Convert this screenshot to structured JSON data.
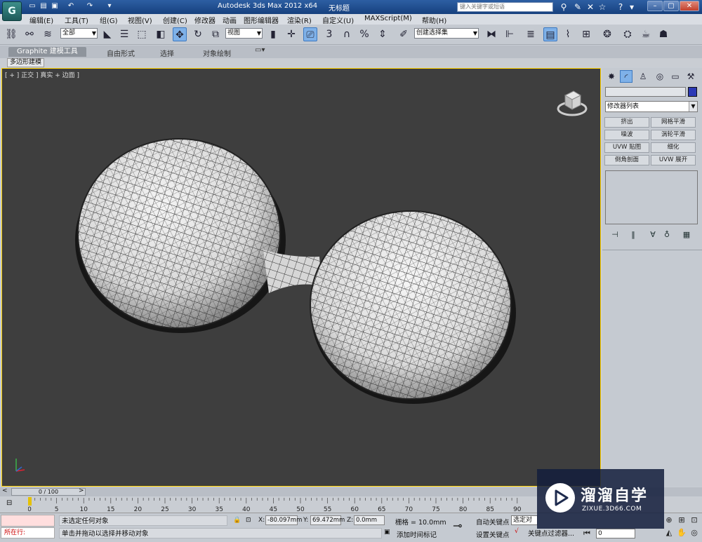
{
  "title_bar": {
    "app_title": "Autodesk 3ds Max  2012 x64",
    "document": "无标题",
    "search_placeholder": "键入关键字或短语",
    "logo_letter": "G"
  },
  "menu": [
    "编辑(E)",
    "工具(T)",
    "组(G)",
    "视图(V)",
    "创建(C)",
    "修改器",
    "动画",
    "图形编辑器",
    "渲染(R)",
    "自定义(U)",
    "MAXScript(M)",
    "帮助(H)"
  ],
  "toolbar": {
    "selection_filter": "全部",
    "ref_coord": "视图",
    "named_selection": "创建选择集",
    "snap_label": "3",
    "percent_label": "%"
  },
  "ribbon": {
    "tabs": [
      "Graphite 建模工具",
      "自由形式",
      "选择",
      "对象绘制"
    ],
    "sub_label": "多边形建模"
  },
  "viewport": {
    "label": "[ + ] 正交 ] 真实 + 边面 ]"
  },
  "command_panel": {
    "modifier_list": "修改器列表",
    "modifier_buttons": [
      "挤出",
      "网格平滑",
      "噪波",
      "涡轮平滑",
      "UVW 贴图",
      "细化",
      "倒角剖面",
      "UVW 展开"
    ],
    "object_color": "#2b39b5"
  },
  "timeline": {
    "position": "0 / 100",
    "ticks": [
      "0",
      "5",
      "10",
      "15",
      "20",
      "25",
      "30",
      "35",
      "40",
      "45",
      "50",
      "55",
      "60",
      "65",
      "70",
      "75",
      "80",
      "85",
      "90"
    ]
  },
  "status": {
    "listener_text": "所在行:",
    "selection_status": "未选定任何对象",
    "prompt": "单击并拖动以选择并移动对象",
    "x_label": "X:",
    "x_value": "-80.097mm",
    "y_label": "Y:",
    "y_value": "69.472mm",
    "z_label": "Z:",
    "z_value": "0.0mm",
    "grid": "栅格 = 10.0mm",
    "add_time_tag": "添加时间标记",
    "auto_key": "自动关键点",
    "set_key": "设置关键点",
    "selected": "选定对象",
    "key_filters": "关键点过滤器...",
    "frame": "0"
  },
  "watermark": {
    "brand": "溜溜自学",
    "url": "ZIXUE.3D66.COM"
  }
}
